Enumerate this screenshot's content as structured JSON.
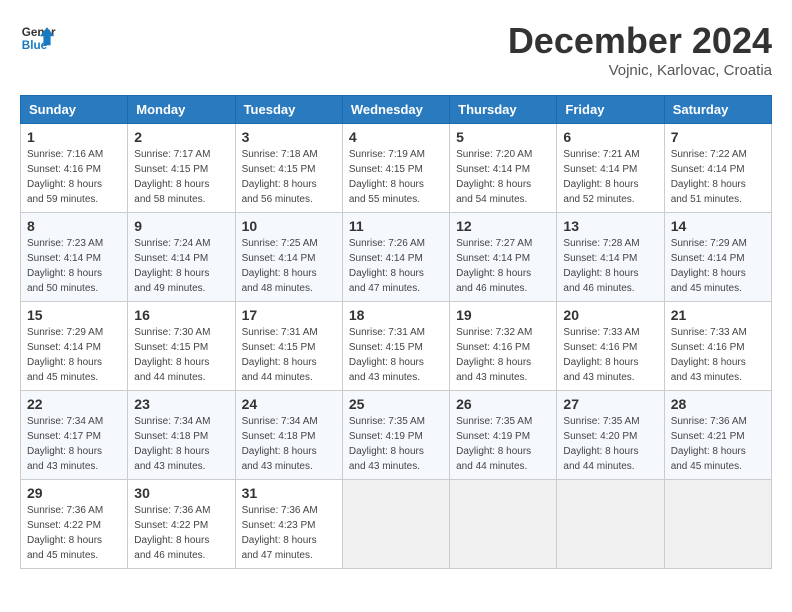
{
  "logo": {
    "line1": "General",
    "line2": "Blue"
  },
  "title": "December 2024",
  "subtitle": "Vojnic, Karlovac, Croatia",
  "weekdays": [
    "Sunday",
    "Monday",
    "Tuesday",
    "Wednesday",
    "Thursday",
    "Friday",
    "Saturday"
  ],
  "weeks": [
    [
      {
        "day": "1",
        "sunrise": "7:16 AM",
        "sunset": "4:16 PM",
        "daylight": "8 hours and 59 minutes."
      },
      {
        "day": "2",
        "sunrise": "7:17 AM",
        "sunset": "4:15 PM",
        "daylight": "8 hours and 58 minutes."
      },
      {
        "day": "3",
        "sunrise": "7:18 AM",
        "sunset": "4:15 PM",
        "daylight": "8 hours and 56 minutes."
      },
      {
        "day": "4",
        "sunrise": "7:19 AM",
        "sunset": "4:15 PM",
        "daylight": "8 hours and 55 minutes."
      },
      {
        "day": "5",
        "sunrise": "7:20 AM",
        "sunset": "4:14 PM",
        "daylight": "8 hours and 54 minutes."
      },
      {
        "day": "6",
        "sunrise": "7:21 AM",
        "sunset": "4:14 PM",
        "daylight": "8 hours and 52 minutes."
      },
      {
        "day": "7",
        "sunrise": "7:22 AM",
        "sunset": "4:14 PM",
        "daylight": "8 hours and 51 minutes."
      }
    ],
    [
      {
        "day": "8",
        "sunrise": "7:23 AM",
        "sunset": "4:14 PM",
        "daylight": "8 hours and 50 minutes."
      },
      {
        "day": "9",
        "sunrise": "7:24 AM",
        "sunset": "4:14 PM",
        "daylight": "8 hours and 49 minutes."
      },
      {
        "day": "10",
        "sunrise": "7:25 AM",
        "sunset": "4:14 PM",
        "daylight": "8 hours and 48 minutes."
      },
      {
        "day": "11",
        "sunrise": "7:26 AM",
        "sunset": "4:14 PM",
        "daylight": "8 hours and 47 minutes."
      },
      {
        "day": "12",
        "sunrise": "7:27 AM",
        "sunset": "4:14 PM",
        "daylight": "8 hours and 46 minutes."
      },
      {
        "day": "13",
        "sunrise": "7:28 AM",
        "sunset": "4:14 PM",
        "daylight": "8 hours and 46 minutes."
      },
      {
        "day": "14",
        "sunrise": "7:29 AM",
        "sunset": "4:14 PM",
        "daylight": "8 hours and 45 minutes."
      }
    ],
    [
      {
        "day": "15",
        "sunrise": "7:29 AM",
        "sunset": "4:14 PM",
        "daylight": "8 hours and 45 minutes."
      },
      {
        "day": "16",
        "sunrise": "7:30 AM",
        "sunset": "4:15 PM",
        "daylight": "8 hours and 44 minutes."
      },
      {
        "day": "17",
        "sunrise": "7:31 AM",
        "sunset": "4:15 PM",
        "daylight": "8 hours and 44 minutes."
      },
      {
        "day": "18",
        "sunrise": "7:31 AM",
        "sunset": "4:15 PM",
        "daylight": "8 hours and 43 minutes."
      },
      {
        "day": "19",
        "sunrise": "7:32 AM",
        "sunset": "4:16 PM",
        "daylight": "8 hours and 43 minutes."
      },
      {
        "day": "20",
        "sunrise": "7:33 AM",
        "sunset": "4:16 PM",
        "daylight": "8 hours and 43 minutes."
      },
      {
        "day": "21",
        "sunrise": "7:33 AM",
        "sunset": "4:16 PM",
        "daylight": "8 hours and 43 minutes."
      }
    ],
    [
      {
        "day": "22",
        "sunrise": "7:34 AM",
        "sunset": "4:17 PM",
        "daylight": "8 hours and 43 minutes."
      },
      {
        "day": "23",
        "sunrise": "7:34 AM",
        "sunset": "4:18 PM",
        "daylight": "8 hours and 43 minutes."
      },
      {
        "day": "24",
        "sunrise": "7:34 AM",
        "sunset": "4:18 PM",
        "daylight": "8 hours and 43 minutes."
      },
      {
        "day": "25",
        "sunrise": "7:35 AM",
        "sunset": "4:19 PM",
        "daylight": "8 hours and 43 minutes."
      },
      {
        "day": "26",
        "sunrise": "7:35 AM",
        "sunset": "4:19 PM",
        "daylight": "8 hours and 44 minutes."
      },
      {
        "day": "27",
        "sunrise": "7:35 AM",
        "sunset": "4:20 PM",
        "daylight": "8 hours and 44 minutes."
      },
      {
        "day": "28",
        "sunrise": "7:36 AM",
        "sunset": "4:21 PM",
        "daylight": "8 hours and 45 minutes."
      }
    ],
    [
      {
        "day": "29",
        "sunrise": "7:36 AM",
        "sunset": "4:22 PM",
        "daylight": "8 hours and 45 minutes."
      },
      {
        "day": "30",
        "sunrise": "7:36 AM",
        "sunset": "4:22 PM",
        "daylight": "8 hours and 46 minutes."
      },
      {
        "day": "31",
        "sunrise": "7:36 AM",
        "sunset": "4:23 PM",
        "daylight": "8 hours and 47 minutes."
      },
      null,
      null,
      null,
      null
    ]
  ]
}
